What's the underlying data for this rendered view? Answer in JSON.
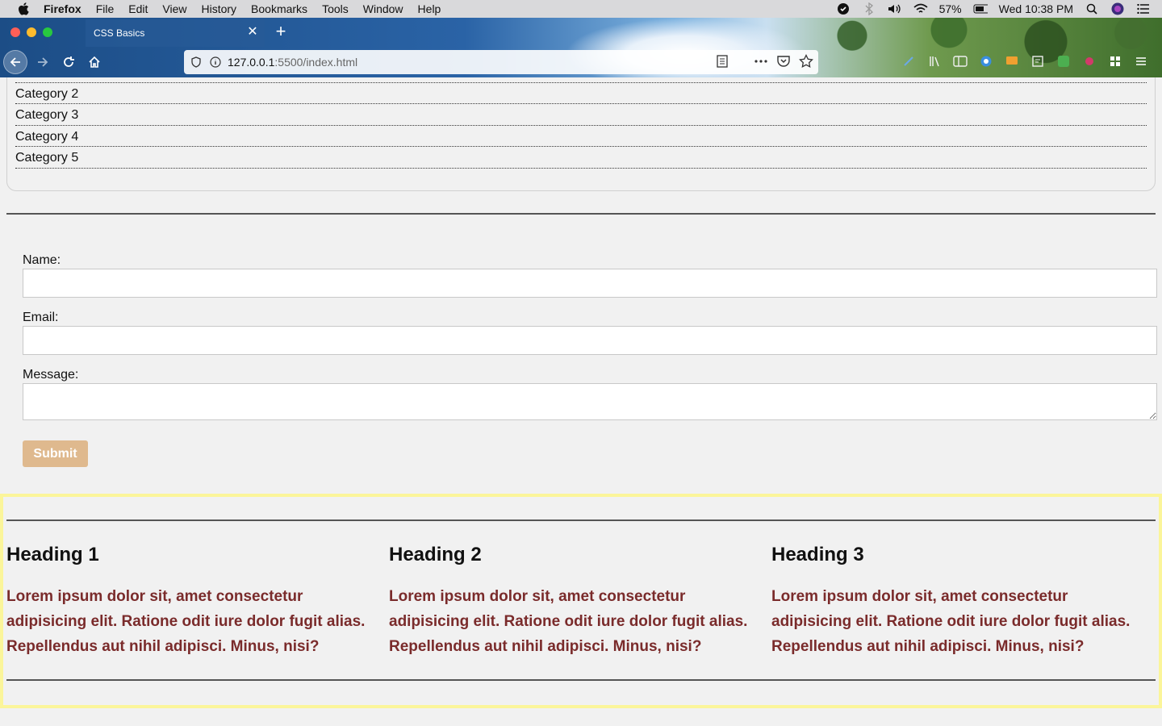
{
  "menubar": {
    "items": [
      "Firefox",
      "File",
      "Edit",
      "View",
      "History",
      "Bookmarks",
      "Tools",
      "Window",
      "Help"
    ],
    "battery": "57%",
    "clock": "Wed 10:38 PM"
  },
  "browser": {
    "tab_title": "CSS Basics",
    "url_host": "127.0.0.1",
    "url_rest": ":5500/index.html"
  },
  "categories": [
    "Category 2",
    "Category 3",
    "Category 4",
    "Category 5"
  ],
  "form": {
    "name_label": "Name:",
    "email_label": "Email:",
    "message_label": "Message:",
    "name_value": "",
    "email_value": "",
    "message_value": "",
    "submit_label": "Submit"
  },
  "features": [
    {
      "heading": "Heading 1",
      "text": "Lorem ipsum dolor sit, amet consectetur adipisicing elit. Ratione odit iure dolor fugit alias. Repellendus aut nihil adipisci. Minus, nisi?"
    },
    {
      "heading": "Heading 2",
      "text": "Lorem ipsum dolor sit, amet consectetur adipisicing elit. Ratione odit iure dolor fugit alias. Repellendus aut nihil adipisci. Minus, nisi?"
    },
    {
      "heading": "Heading 3",
      "text": "Lorem ipsum dolor sit, amet consectetur adipisicing elit. Ratione odit iure dolor fugit alias. Repellendus aut nihil adipisci. Minus, nisi?"
    }
  ],
  "colors": {
    "accent_text": "#7a2b2b",
    "submit_bg": "#dfb98e",
    "highlight_border": "#fbf59a"
  }
}
